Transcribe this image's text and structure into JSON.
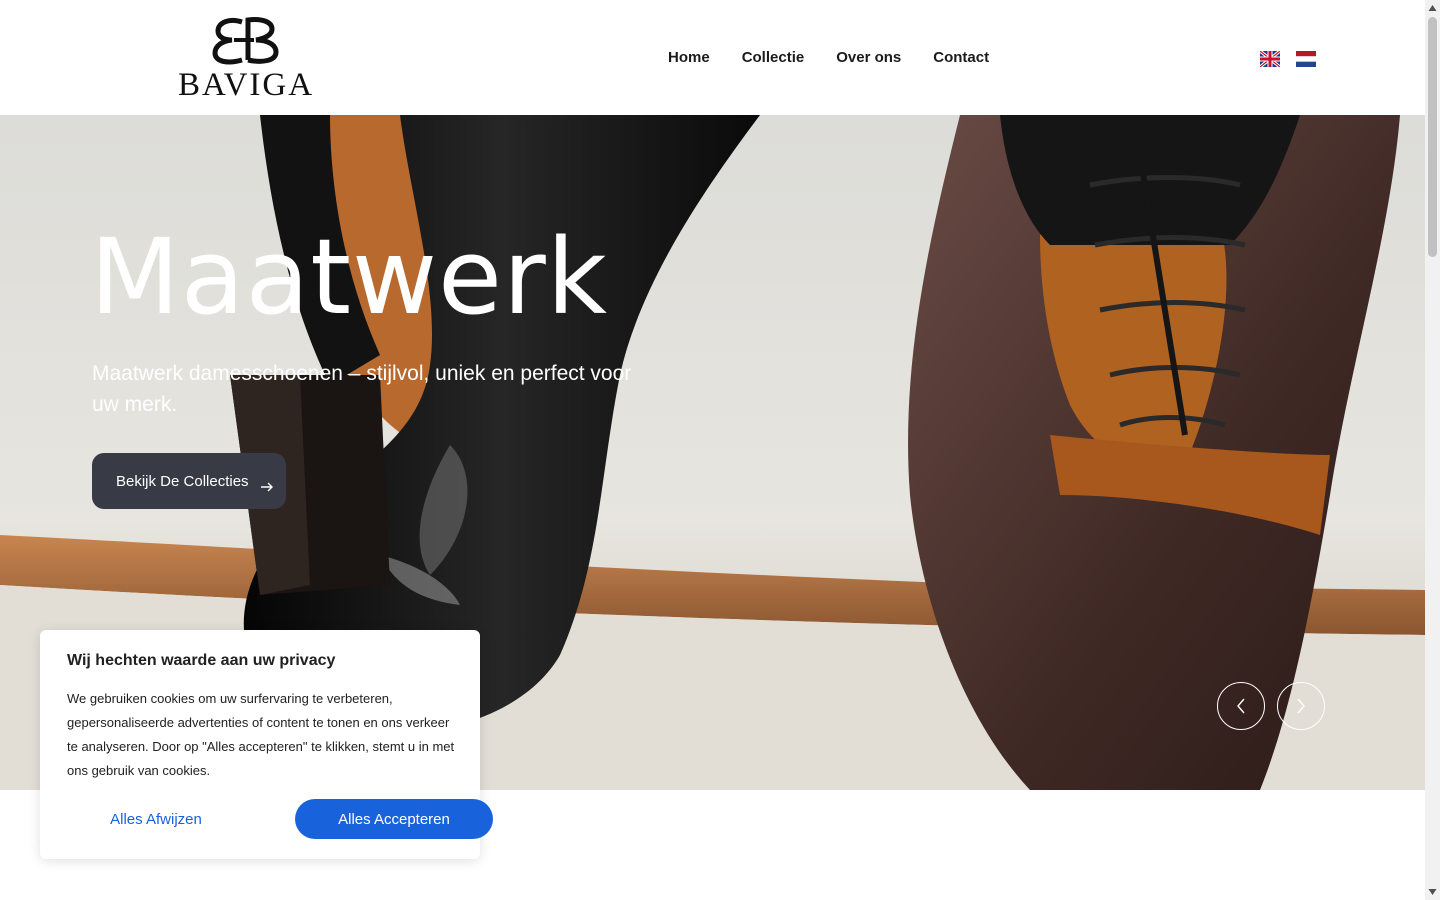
{
  "brand": {
    "monogram": "BB",
    "name": "BAVIGA"
  },
  "nav": {
    "items": [
      "Home",
      "Collectie",
      "Over ons",
      "Contact"
    ]
  },
  "languages": [
    {
      "icon": "uk-flag-icon",
      "code": "en"
    },
    {
      "icon": "nl-flag-icon",
      "code": "nl"
    }
  ],
  "hero": {
    "title": "Maatwerk",
    "subtitle": "Maatwerk damesschoenen – stijlvol, uniek en perfect voor uw merk.",
    "cta_label": "Bekijk De Collecties",
    "cta_icon": "arrow-right-icon",
    "prev_icon": "chevron-left-icon",
    "next_icon": "chevron-right-icon"
  },
  "cookie": {
    "title": "Wij hechten waarde aan uw privacy",
    "body": "We gebruiken cookies om uw surfervaring te verbeteren, gepersonaliseerde advertenties of content te tonen en ons verkeer te analyseren. Door op \"Alles accepteren\" te klikken, stemt u in met ons gebruik van cookies.",
    "reject_label": "Alles Afwijzen",
    "accept_label": "Alles Accepteren"
  },
  "colors": {
    "accent": "#1863dc",
    "cta": "#383a45",
    "text": "#1b1b1b"
  }
}
